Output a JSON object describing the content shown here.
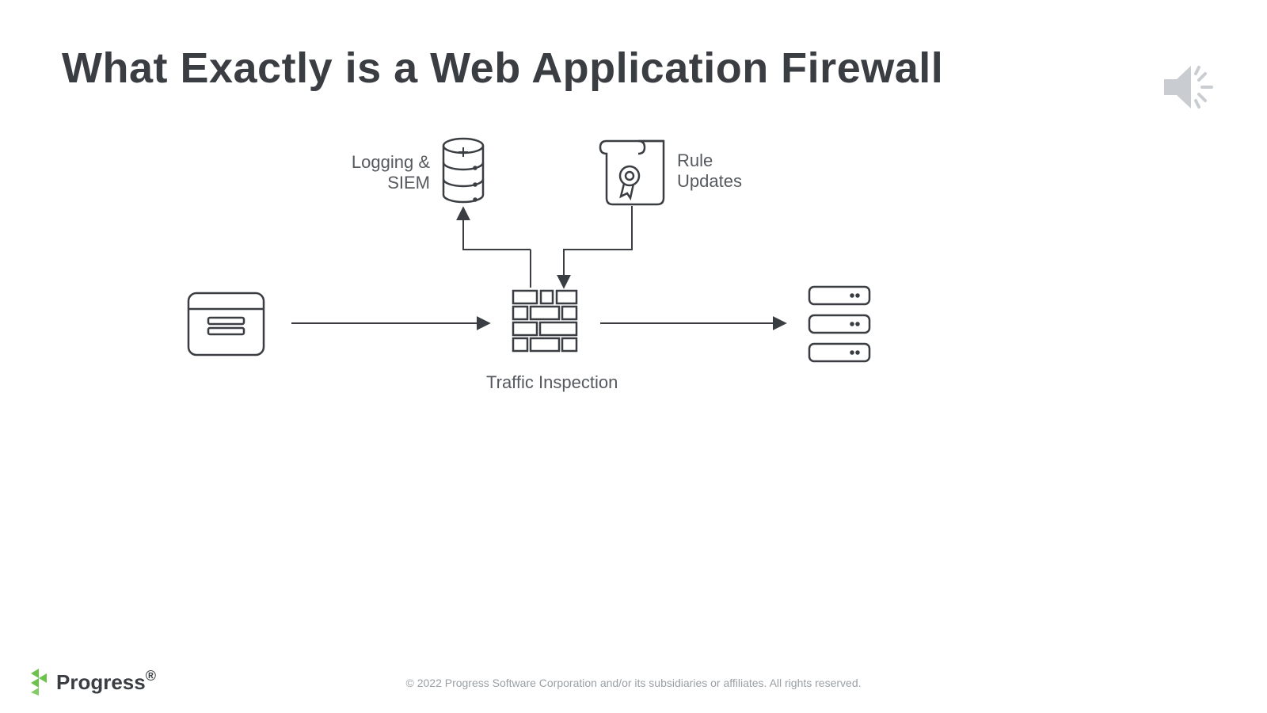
{
  "title": "What Exactly is a Web Application Firewall",
  "labels": {
    "logging": "Logging &\nSIEM",
    "rules": "Rule\nUpdates",
    "traffic": "Traffic Inspection"
  },
  "footer": "© 2022 Progress Software Corporation and/or its subsidiaries or affiliates. All rights reserved.",
  "logo_text": "Progress",
  "logo_accent": "#6CC24A",
  "stroke": "#3a3e43"
}
